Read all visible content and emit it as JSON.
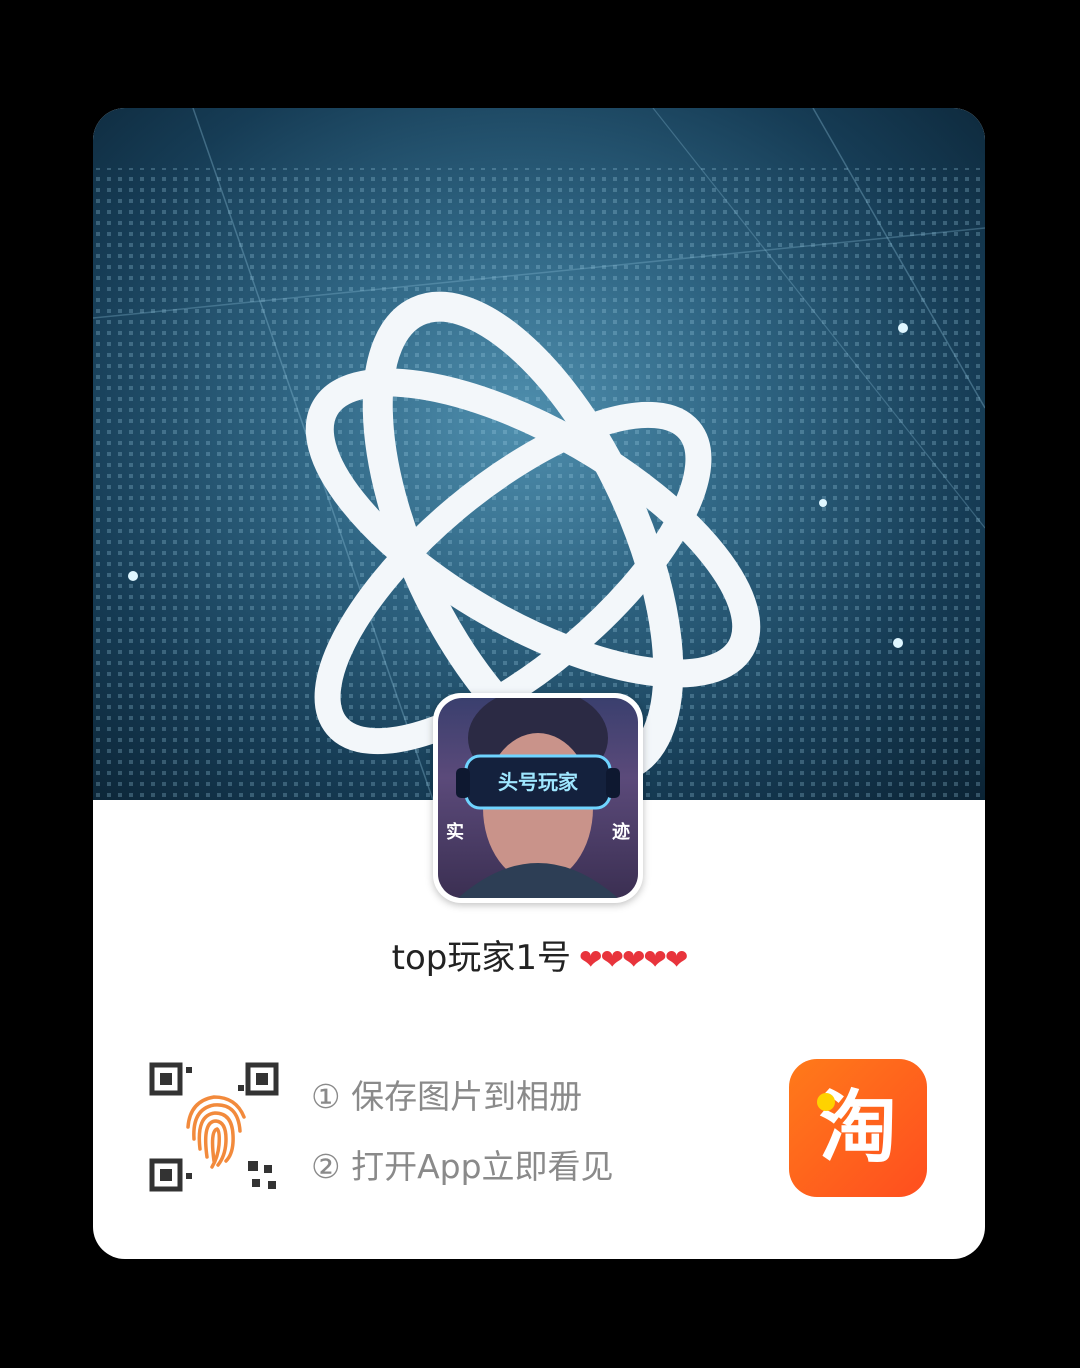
{
  "avatar": {
    "screen_title": "头号玩家",
    "left_tag": "实",
    "right_tag": "迹"
  },
  "profile": {
    "name": "top玩家1号",
    "hearts": "❤❤❤❤❤"
  },
  "instructions": {
    "step1": "① 保存图片到相册",
    "step2": "② 打开App立即看见"
  },
  "app_icon": {
    "char": "淘",
    "name": "taobao-icon"
  },
  "colors": {
    "accent_orange": "#ff5a1f",
    "heart_red": "#e8343c",
    "fingerprint": "#f28a3c"
  }
}
